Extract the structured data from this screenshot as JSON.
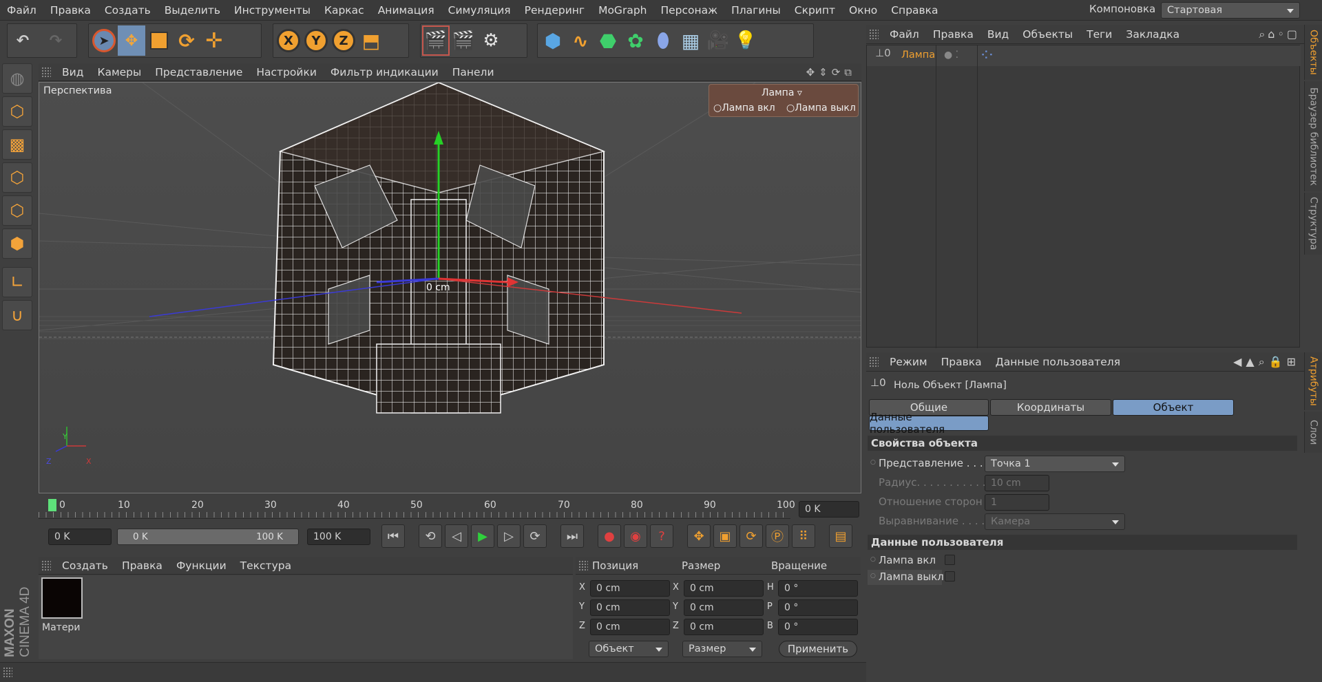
{
  "menubar": {
    "items": [
      "Файл",
      "Правка",
      "Создать",
      "Выделить",
      "Инструменты",
      "Каркас",
      "Анимация",
      "Симуляция",
      "Рендеринг",
      "MoGraph",
      "Персонаж",
      "Плагины",
      "Скрипт",
      "Окно",
      "Справка"
    ],
    "layout_label": "Компоновка",
    "layout_value": "Стартовая"
  },
  "toolbar": {
    "axis_x": "X",
    "axis_y": "Y",
    "axis_z": "Z"
  },
  "viewport": {
    "menu": [
      "Вид",
      "Камеры",
      "Представление",
      "Настройки",
      "Фильтр индикации",
      "Панели"
    ],
    "camera_label": "Перспектива",
    "hud_title": "Лампа",
    "hud_on": "Лампа вкл",
    "hud_off": "Лампа выкл",
    "origin_label": "0 cm",
    "axis_y": "Y",
    "axis_x": "X",
    "axis_z": "Z"
  },
  "timeline": {
    "ticks": [
      "0",
      "10",
      "20",
      "30",
      "40",
      "50",
      "60",
      "70",
      "80",
      "90",
      "100"
    ],
    "current_frame": "0 K",
    "start": "0 K",
    "range_start": "0 K",
    "range_end": "100 K",
    "end": "100 K"
  },
  "objects_panel": {
    "menu": [
      "Файл",
      "Правка",
      "Вид",
      "Объекты",
      "Теги",
      "Закладка"
    ],
    "items": [
      {
        "name": "Лампа"
      }
    ],
    "side_tabs": [
      "Объекты",
      "Браузер библиотек",
      "Структура"
    ]
  },
  "attributes_panel": {
    "menu": [
      "Режим",
      "Правка",
      "Данные пользователя"
    ],
    "object_title": "Ноль Объект [Лампа]",
    "tabs": [
      "Общие",
      "Координаты",
      "Объект"
    ],
    "active_tab": "Объект",
    "subtab": "Данные пользователя",
    "section_props": "Свойства объекта",
    "display_label": "Представление . . . .",
    "display_value": "Точка 1",
    "radius_label": "Радиус. . . . . . . . . . .",
    "radius_value": "10 cm",
    "aspect_label": "Отношение сторон",
    "aspect_value": "1",
    "align_label": "Выравнивание . . . .",
    "align_value": "Камера",
    "section_user": "Данные пользователя",
    "lamp_on": "Лампа вкл",
    "lamp_off": "Лампа выкл",
    "side_tabs": [
      "Атрибуты",
      "Слои"
    ]
  },
  "materials": {
    "menu": [
      "Создать",
      "Правка",
      "Функции",
      "Текстура"
    ],
    "item_label": "Матери"
  },
  "coords": {
    "headers": [
      "Позиция",
      "Размер",
      "Вращение"
    ],
    "pos": [
      "0 cm",
      "0 cm",
      "0 cm"
    ],
    "size": [
      "0 cm",
      "0 cm",
      "0 cm"
    ],
    "rot": [
      "0 °",
      "0 °",
      "0 °"
    ],
    "pos_axes": [
      "X",
      "Y",
      "Z"
    ],
    "size_axes": [
      "X",
      "Y",
      "Z"
    ],
    "rot_axes": [
      "H",
      "P",
      "B"
    ],
    "mode_object": "Объект",
    "mode_size": "Размер",
    "apply": "Применить"
  },
  "brand": {
    "maxon": "MAXON",
    "product": "CINEMA 4D"
  },
  "colors": {
    "accent": "#f0a030",
    "selected": "#7a9cc6",
    "bg": "#3f3f3f"
  }
}
